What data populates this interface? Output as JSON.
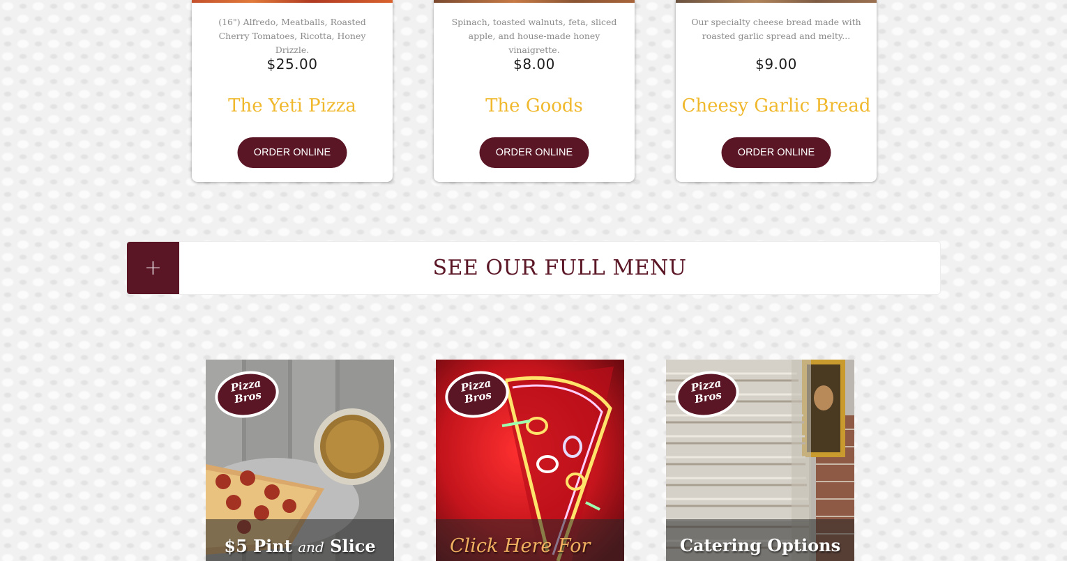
{
  "menu_cards": [
    {
      "description": "(16\") Alfredo, Meatballs, Roasted Cherry Tomatoes, Ricotta, Honey Drizzle.",
      "price": "$25.00",
      "title": "The Yeti Pizza",
      "button_label": "ORDER ONLINE"
    },
    {
      "description": "Spinach, toasted walnuts, feta, sliced apple, and house-made honey vinaigrette.",
      "price": "$8.00",
      "title": "The Goods",
      "button_label": "ORDER ONLINE"
    },
    {
      "description": "Our specialty cheese bread made with roasted garlic spread and melty...",
      "price": "$9.00",
      "title": "Cheesy Garlic Bread",
      "button_label": "ORDER ONLINE"
    }
  ],
  "full_menu": {
    "toggle_icon": "plus-icon",
    "toggle_symbol": "+",
    "title": "SEE OUR FULL MENU"
  },
  "promos": [
    {
      "logo_text_1": "Pizza",
      "logo_text_2": "Bros",
      "caption_a": "$5 Pint",
      "caption_b": "and",
      "caption_c": "Slice"
    },
    {
      "logo_text_1": "Pizza",
      "logo_text_2": "Bros",
      "caption": "Click Here For"
    },
    {
      "logo_text_1": "Pizza",
      "logo_text_2": "Bros",
      "caption": "Catering Options"
    }
  ],
  "colors": {
    "brand_maroon": "#5b1626",
    "title_gold": "#f0b82c",
    "page_bg": "#f1f1f1"
  }
}
